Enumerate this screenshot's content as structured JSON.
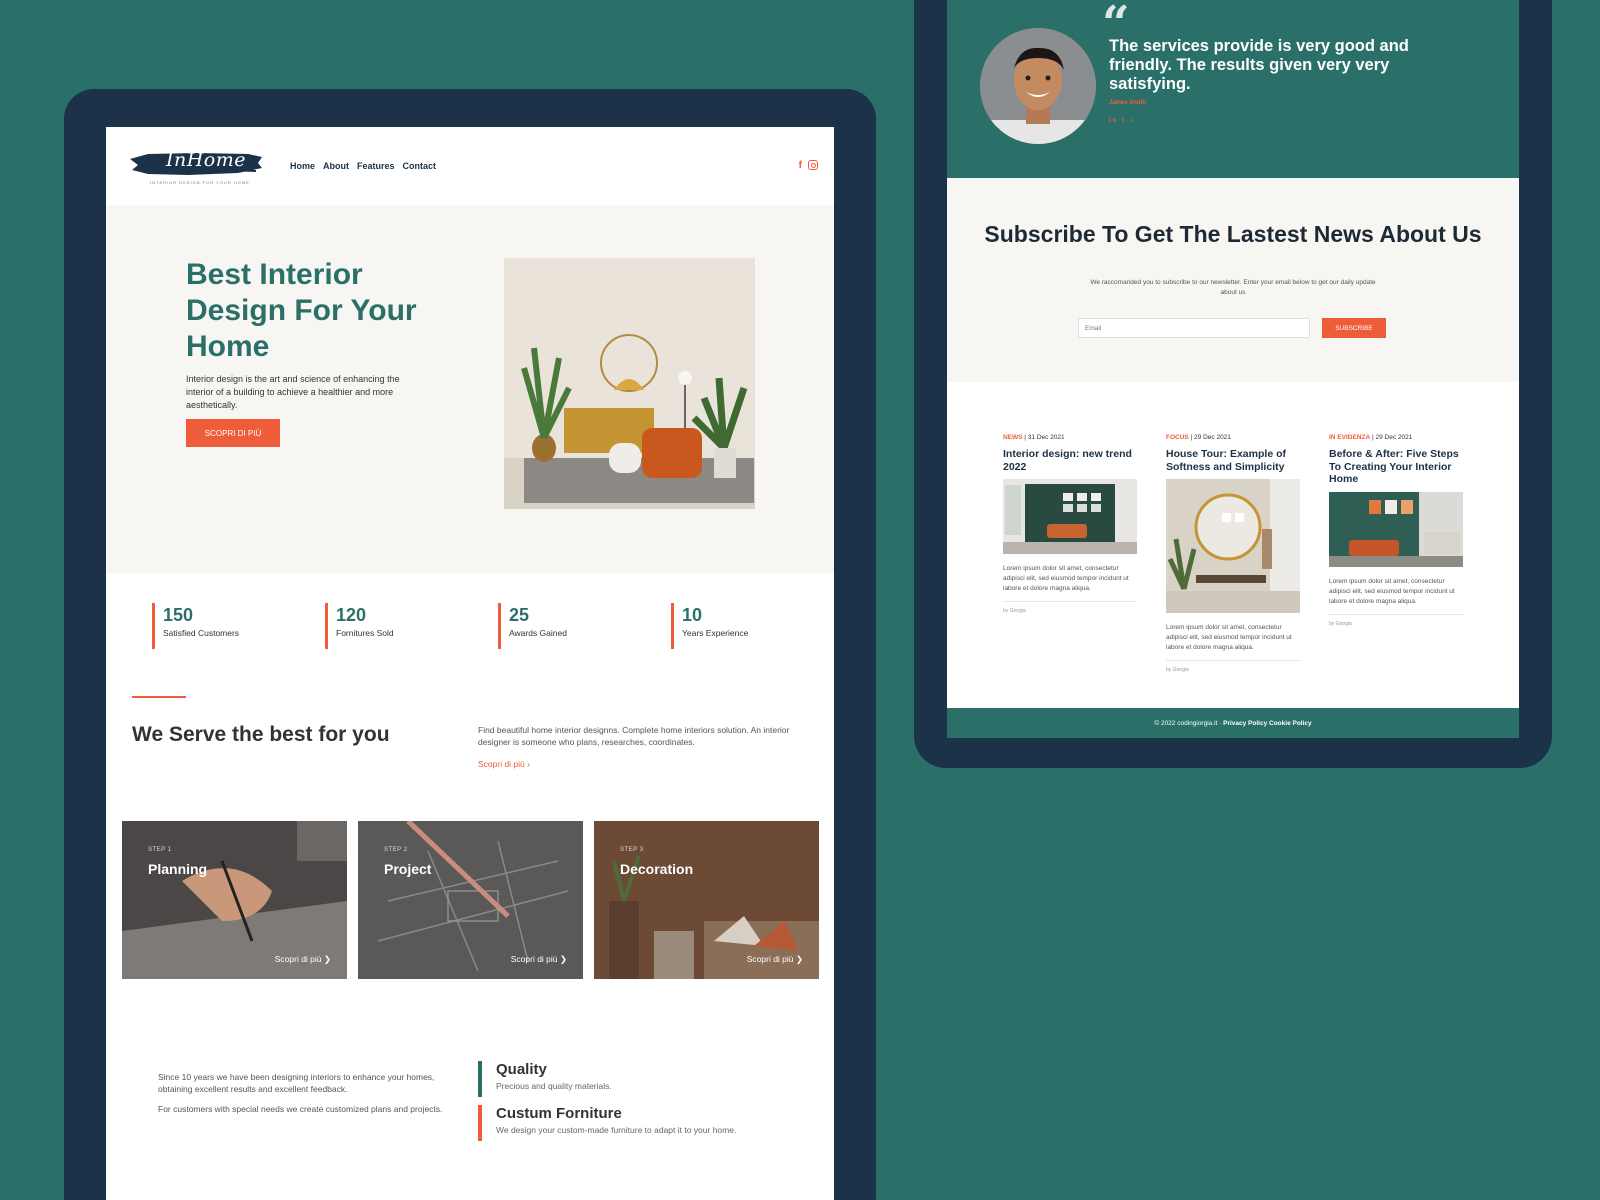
{
  "left": {
    "logo": {
      "text": "InHome",
      "tagline": "INTERIOR DESIGN FOR YOUR HOME"
    },
    "nav": [
      "Home",
      "About",
      "Features",
      "Contact"
    ],
    "social_icons": [
      "facebook-icon",
      "instagram-icon"
    ],
    "hero": {
      "title": "Best Interior Design For Your Home",
      "text": "Interior design is the art and science of enhancing the interior of a building to achieve a healthier and more aesthetically.",
      "button": "SCOPRI DI PIÙ"
    },
    "stats": [
      {
        "value": "150",
        "label": "Satisfied Customers"
      },
      {
        "value": "120",
        "label": "Fornitures Sold"
      },
      {
        "value": "25",
        "label": "Awards Gained"
      },
      {
        "value": "10",
        "label": "Years Experience"
      }
    ],
    "serve": {
      "title": "We Serve the best for you",
      "text": "Find beautiful home interior designns. Complete home interiors solution. An interior designer is someone who plans, researches, coordinates.",
      "link": "Scopri di più ›"
    },
    "steps": [
      {
        "sub": "STEP 1",
        "title": "Planning",
        "link": "Scopri di più ❯"
      },
      {
        "sub": "STEP 2",
        "title": "Project",
        "link": "Scopri di più ❯"
      },
      {
        "sub": "STEP 3",
        "title": "Decoration",
        "link": "Scopri di più ❯"
      }
    ],
    "about": {
      "p1": "Since 10 years we have been designing interiors to enhance your homes, obtaining excellent results and excellent feedback.",
      "p2": "For customers with special needs we create customized plans and projects."
    },
    "features": [
      {
        "title": "Quality",
        "desc": "Precious and quality materials."
      },
      {
        "title": "Custum Forniture",
        "desc": "We design your custom-made furniture to adapt it to your home."
      }
    ]
  },
  "right": {
    "testimonial": {
      "quote_mark": "“",
      "text": "The services provide is very good and friendly. The results given very very satisfying.",
      "name": "James Smith",
      "social": "in f ✓"
    },
    "subscribe": {
      "title": "Subscribe To Get The Lastest News About Us",
      "text": "We raccomanded you to subscribe to our newsletter. Enter your email below to get our daily update about us",
      "placeholder": "Email",
      "button": "SUBSCRIBE"
    },
    "posts": [
      {
        "category": "NEWS",
        "date": " | 31 Dec 2021",
        "title": "Interior design: new trend 2022",
        "text": "Lorem ipsum dolor sit amet, consectetur adipisci elit, sed eiusmod tempor incidunt ut labore et dolore magna aliqua.",
        "by": "by Giorgia"
      },
      {
        "category": "FOCUS",
        "date": " | 29 Dec 2021",
        "title": "House Tour: Example of Softness and Simplicity",
        "text": "Lorem ipsum dolor sit amet, consectetur adipisci elit, sed eiusmod tempor incidunt ut labore et dolore magna aliqua.",
        "by": "by Giorgia"
      },
      {
        "category": "IN EVIDENZA",
        "date": " | 29 Dec 2021",
        "title": "Before & After: Five Steps To Creating Your Interior Home",
        "text": "Lorem ipsum dolor sit amet, consectetur adipisci elit, sed eiusmod tempor incidunt ut labore et dolore magna aliqua.",
        "by": "by Giorgia"
      }
    ],
    "footer": {
      "copy": "© 2022 codingiorgia.it · ",
      "privacy": "Privacy Policy",
      "cookie": "Cookie Policy"
    }
  },
  "colors": {
    "teal": "#2a7069",
    "navy": "#1b3249",
    "orange": "#ef5c3a",
    "cream": "#f8f6f2"
  }
}
